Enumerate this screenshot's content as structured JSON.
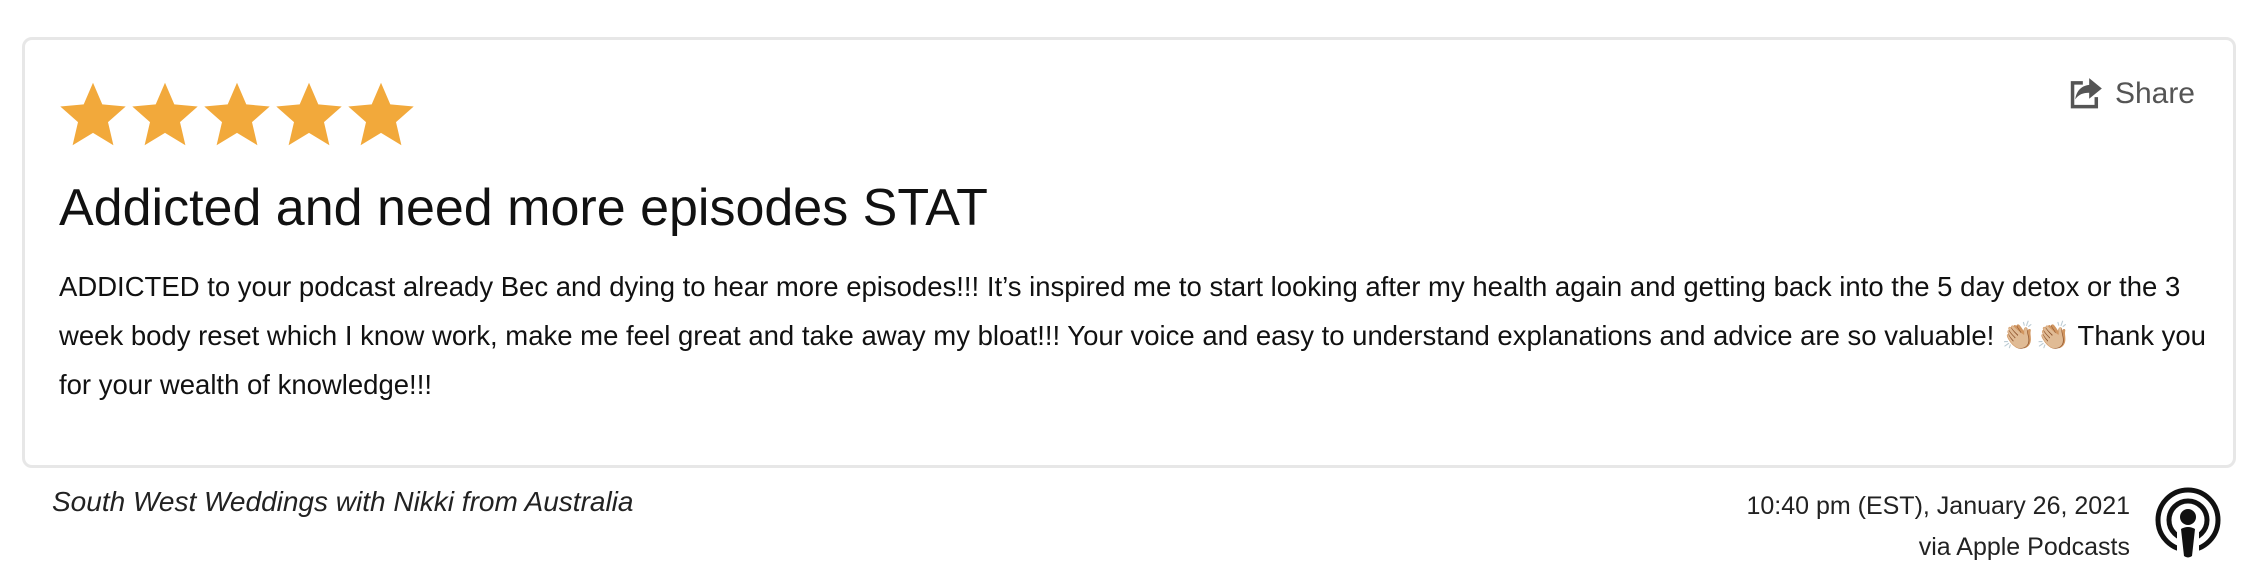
{
  "review": {
    "rating": 5,
    "rating_max": 5,
    "title": "Addicted and need more episodes STAT",
    "body": "ADDICTED to your podcast already Bec and dying to hear more episodes!!! It’s inspired me to start looking after my health again and getting back into the 5 day detox or the 3 week body reset which I know work, make me feel great and take away my bloat!!! Your voice and easy to understand explanations and advice are so valuable! 👏🏼👏🏼 Thank you for your wealth of knowledge!!!",
    "share_label": "Share",
    "reviewer": "South West Weddings with Nikki from Australia",
    "timestamp": "10:40 pm (EST), January 26, 2021",
    "source": "via Apple Podcasts"
  },
  "colors": {
    "star": "#F2A93B",
    "card_border": "#E7E7E7",
    "share": "#555555"
  },
  "icons": {
    "star": "star-icon",
    "share": "share-icon",
    "source": "apple-podcasts-icon"
  }
}
